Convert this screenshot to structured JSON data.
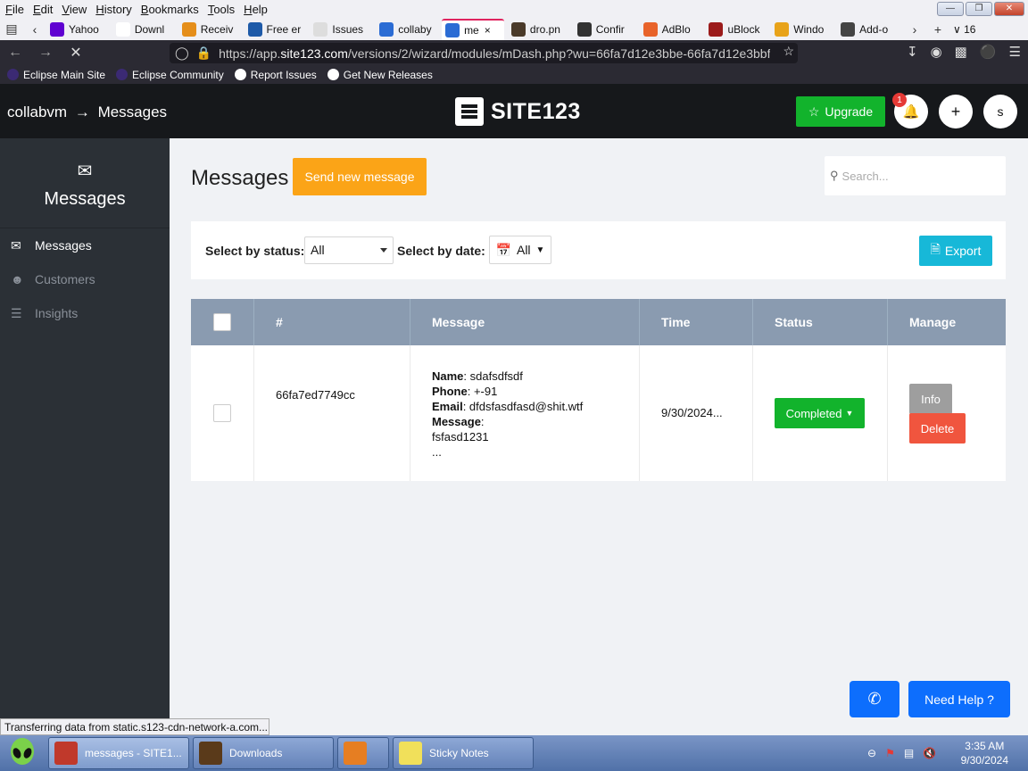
{
  "menubar": {
    "items": [
      "File",
      "Edit",
      "View",
      "History",
      "Bookmarks",
      "Tools",
      "Help"
    ]
  },
  "tabs": [
    {
      "label": "Yahoo",
      "color": "#5f01d1"
    },
    {
      "label": "Downl",
      "color": "#ffffff"
    },
    {
      "label": "Receiv",
      "color": "#e58e1a"
    },
    {
      "label": "Free er",
      "color": "#1e5aa8"
    },
    {
      "label": "Issues",
      "color": "#dddddd"
    },
    {
      "label": "collaby",
      "color": "#2b6cd4"
    },
    {
      "label": "me",
      "color": "#2b6cd4",
      "active": true
    },
    {
      "label": "dro.pn",
      "color": "#4a3a2a"
    },
    {
      "label": "Confir",
      "color": "#333333"
    },
    {
      "label": "AdBlo",
      "color": "#e8632a"
    },
    {
      "label": "uBlock",
      "color": "#9b1b1b"
    },
    {
      "label": "Windo",
      "color": "#e8a31a"
    },
    {
      "label": "Add-o",
      "color": "#444444"
    }
  ],
  "tab_count": "16",
  "url": {
    "prefix": "https://app.",
    "host": "site123.com",
    "path": "/versions/2/wizard/modules/mDash.php?wu=66fa7d12e3bbe-66fa7d12e3bbf"
  },
  "bookmarks": [
    {
      "label": "Eclipse Main Site",
      "color": "#3b2a73"
    },
    {
      "label": "Eclipse Community",
      "color": "#3b2a73"
    },
    {
      "label": "Report Issues",
      "color": "#ffffff"
    },
    {
      "label": "Get New Releases",
      "color": "#ffffff"
    }
  ],
  "app": {
    "breadcrumb_site": "collabvm",
    "breadcrumb_arrow": "→",
    "breadcrumb_page": "Messages",
    "logo_text": "SITE123",
    "upgrade_label": "Upgrade",
    "notif_count": "1",
    "user_initial": "s"
  },
  "sidebar": {
    "title": "Messages",
    "items": [
      {
        "label": "Messages",
        "icon": "envelope-icon",
        "active": true
      },
      {
        "label": "Customers",
        "icon": "users-icon",
        "active": false
      },
      {
        "label": "Insights",
        "icon": "chart-icon",
        "active": false
      }
    ]
  },
  "main": {
    "title": "Messages",
    "send_label": "Send new message",
    "search_placeholder": "Search...",
    "status_label": "Select by status:",
    "status_value": "All",
    "date_label": "Select by date:",
    "date_value": "All",
    "export_label": "Export"
  },
  "table": {
    "headers": [
      "#",
      "Message",
      "Time",
      "Status",
      "Manage"
    ],
    "rows": [
      {
        "id": "66fa7ed7749cc",
        "name_label": "Name",
        "name": ": sdafsdfsdf",
        "phone_label": "Phone",
        "phone": ": +-91",
        "email_label": "Email",
        "email": ": dfdsfasdfasd@shit.wtf",
        "message_label": "Message",
        "message_colon": ":",
        "message": "fsfasd1231",
        "ellipsis": "...",
        "time": "9/30/2024...",
        "status": "Completed",
        "info_label": "Info",
        "delete_label": "Delete"
      }
    ]
  },
  "help": {
    "label": "Need Help ?"
  },
  "statusbar": {
    "text": "Transferring data from static.s123-cdn-network-a.com..."
  },
  "taskbar": {
    "tasks": [
      {
        "label": "messages - SITE1...",
        "color": "#c0392b"
      },
      {
        "label": "Downloads",
        "color": "#5a3a1a"
      },
      {
        "label": "",
        "color": "#e67e22"
      },
      {
        "label": "Sticky Notes",
        "color": "#f1e05a"
      }
    ],
    "time": "3:35 AM",
    "date": "9/30/2024"
  }
}
